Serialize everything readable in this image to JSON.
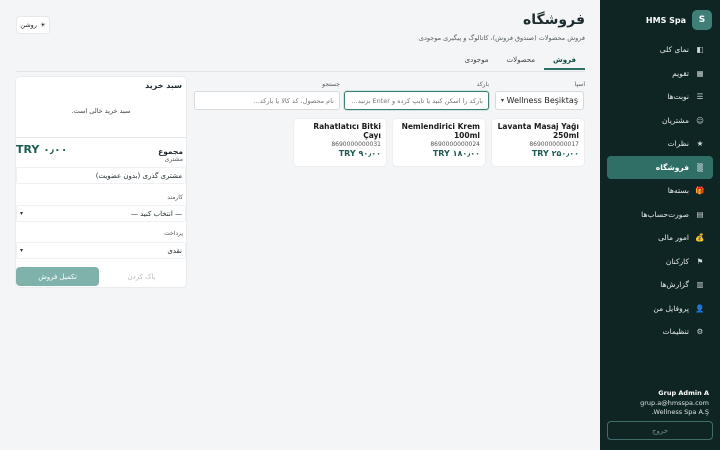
{
  "brand": {
    "logo_letter": "S",
    "name": "HMS Spa"
  },
  "nav": [
    {
      "label": "نمای کلی",
      "icon": "◧",
      "icon_name": "dashboard-icon"
    },
    {
      "label": "تقویم",
      "icon": "▦",
      "icon_name": "calendar-icon"
    },
    {
      "label": "نوبت‌ها",
      "icon": "☰",
      "icon_name": "appointments-icon"
    },
    {
      "label": "مشتریان",
      "icon": "☺",
      "icon_name": "customers-icon"
    },
    {
      "label": "نظرات",
      "icon": "★",
      "icon_name": "star-icon"
    },
    {
      "label": "فروشگاه",
      "icon": "▒",
      "icon_name": "store-icon",
      "active": true
    },
    {
      "label": "بسته‌ها",
      "icon": "🎁",
      "icon_name": "gift-icon"
    },
    {
      "label": "صورت‌حساب‌ها",
      "icon": "▤",
      "icon_name": "invoice-icon"
    },
    {
      "label": "امور مالی",
      "icon": "💰",
      "icon_name": "money-bag-icon"
    },
    {
      "label": "کارکنان",
      "icon": "⚑",
      "icon_name": "flag-icon"
    },
    {
      "label": "گزارش‌ها",
      "icon": "▥",
      "icon_name": "chart-icon"
    },
    {
      "label": "پروفایل من",
      "icon": "👤",
      "icon_name": "profile-icon"
    },
    {
      "label": "تنظیمات",
      "icon": "⚙",
      "icon_name": "gear-icon"
    }
  ],
  "user": {
    "name": "Grup Admin A",
    "email": "grup.a@hmsspa.com",
    "company": "Wellness Spa A.Ş."
  },
  "logout_label": "خروج",
  "theme_toggle": {
    "icon": "☀",
    "label": "روشن"
  },
  "page": {
    "title": "فروشگاه",
    "subtitle": "فروش محصولات (صندوق فروش)، کاتالوگ و پیگیری موجودی"
  },
  "tabs": [
    {
      "label": "فروش",
      "active": true
    },
    {
      "label": "محصولات"
    },
    {
      "label": "موجودی"
    }
  ],
  "filters": {
    "spa_label": "اسپا",
    "spa_value": "Wellness Beşiktaş",
    "barcode_label": "بارکد",
    "barcode_placeholder": "بارکد را اسکن کنید یا تایپ کرده و Enter بزنید...",
    "search_label": "جستجو",
    "search_placeholder": "نام محصول، کد کالا یا بارکد..."
  },
  "products": [
    {
      "name": "Lavanta Masaj Yağı 250ml",
      "code": "8690000000017",
      "price": "TRY ۲۵۰٫۰۰"
    },
    {
      "name": "Nemlendirici Krem 100ml",
      "code": "8690000000024",
      "price": "TRY ۱۸۰٫۰۰"
    },
    {
      "name": "Rahatlatıcı Bitki Çayı",
      "code": "8690000000031",
      "price": "TRY ۹۰٫۰۰"
    }
  ],
  "cart": {
    "title": "سبد خرید",
    "empty_text": "سبد خرید خالی است.",
    "total_label": "مجموع",
    "total_value": "TRY ۰٫۰۰",
    "customer_label": "مشتری",
    "customer_value": "مشتری گذری (بدون عضویت)",
    "staff_label": "کارمند",
    "staff_value": "— انتخاب کنید —",
    "payment_label": "پرداخت",
    "payment_value": "نقدی",
    "clear_label": "پاک کردن",
    "complete_label": "تکمیل فروش"
  }
}
